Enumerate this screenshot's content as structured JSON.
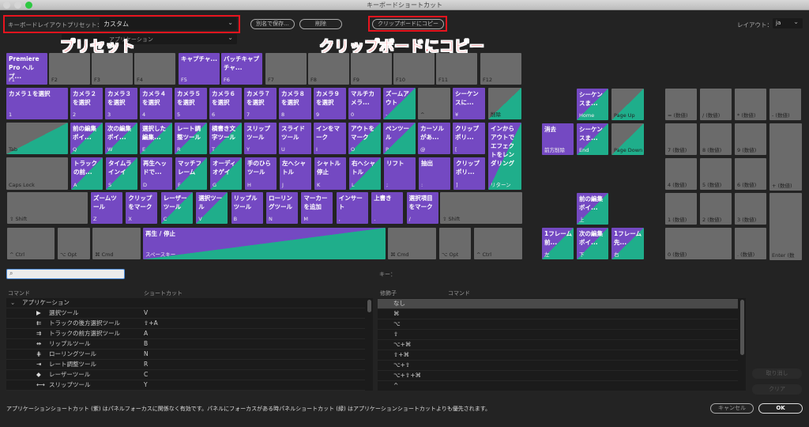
{
  "window": {
    "title": "キーボードショートカット"
  },
  "toolbar": {
    "preset_label": "キーボードレイアウトプリセット：",
    "preset_value": "カスタム",
    "save_as": "別名で保存...",
    "delete": "削除",
    "copy_clipboard": "クリップボードにコピー",
    "layout_label": "レイアウト：",
    "layout_value": "ja",
    "command_set_value": "アプリケーション"
  },
  "annotations": {
    "preset": "プリセット",
    "clipboard": "クリップボードにコピー"
  },
  "colors": {
    "app_shortcut": "#7449c2",
    "panel_shortcut": "#1fae8b",
    "unassigned": "#6b6b6b",
    "annotation": "#e8141e"
  },
  "keys": [
    {
      "k": "F1",
      "l": "Premiere Pro ヘルプ...",
      "s": "p"
    },
    {
      "k": "F2",
      "l": "",
      "s": "g"
    },
    {
      "k": "F3",
      "l": "",
      "s": "g"
    },
    {
      "k": "F4",
      "l": "",
      "s": "g"
    },
    {
      "k": "F5",
      "l": "キャプチャ...",
      "s": "p"
    },
    {
      "k": "F6",
      "l": "バッチキャプチャ...",
      "s": "p"
    },
    {
      "k": "F7",
      "l": "",
      "s": "g"
    },
    {
      "k": "F8",
      "l": "",
      "s": "g"
    },
    {
      "k": "F9",
      "l": "",
      "s": "g"
    },
    {
      "k": "F10",
      "l": "",
      "s": "g"
    },
    {
      "k": "F11",
      "l": "",
      "s": "g"
    },
    {
      "k": "F12",
      "l": "",
      "s": "g"
    },
    {
      "k": "1",
      "l": "カメラ１を選択",
      "s": "p"
    },
    {
      "k": "2",
      "l": "カメラ２を選択",
      "s": "p"
    },
    {
      "k": "3",
      "l": "カメラ３を選択",
      "s": "p"
    },
    {
      "k": "4",
      "l": "カメラ４を選択",
      "s": "p"
    },
    {
      "k": "5",
      "l": "カメラ５を選択",
      "s": "p"
    },
    {
      "k": "6",
      "l": "カメラ６を選択",
      "s": "p"
    },
    {
      "k": "7",
      "l": "カメラ７を選択",
      "s": "p"
    },
    {
      "k": "8",
      "l": "カメラ８を選択",
      "s": "p"
    },
    {
      "k": "9",
      "l": "カメラ９を選択",
      "s": "p"
    },
    {
      "k": "0",
      "l": "マルチカメラ...",
      "s": "p"
    },
    {
      "k": "-",
      "l": "ズームアウト",
      "s": "pg"
    },
    {
      "k": "^",
      "l": "",
      "s": "g"
    },
    {
      "k": "¥",
      "l": "シーケンスに...",
      "s": "p"
    },
    {
      "k": "削除",
      "l": "",
      "s": "gg"
    },
    {
      "k": "Tab",
      "l": "",
      "s": "gg"
    },
    {
      "k": "Q",
      "l": "前の編集ポイ...",
      "s": "pg"
    },
    {
      "k": "W",
      "l": "次の編集ポイ...",
      "s": "pg"
    },
    {
      "k": "E",
      "l": "選択した編集...",
      "s": "pg"
    },
    {
      "k": "R",
      "l": "レート調整ツール",
      "s": "pg"
    },
    {
      "k": "T",
      "l": "横書き文字ツール",
      "s": "pg"
    },
    {
      "k": "Y",
      "l": "スリップツール",
      "s": "p"
    },
    {
      "k": "U",
      "l": "スライドツール",
      "s": "p"
    },
    {
      "k": "I",
      "l": "インをマーク",
      "s": "p"
    },
    {
      "k": "O",
      "l": "アウトをマーク",
      "s": "pg"
    },
    {
      "k": "P",
      "l": "ペンツール",
      "s": "pg"
    },
    {
      "k": "@",
      "l": "カーソルがあ...",
      "s": "p"
    },
    {
      "k": "[",
      "l": "クリップポリ...",
      "s": "p"
    },
    {
      "k": "リターン",
      "l": "インからアウトでエフェクトをレンダリング",
      "s": "pg"
    },
    {
      "k": "Caps Lock",
      "l": "",
      "s": "g"
    },
    {
      "k": "A",
      "l": "トラックの前...",
      "s": "pg"
    },
    {
      "k": "S",
      "l": "タイムラインイン...",
      "s": "pg"
    },
    {
      "k": "D",
      "l": "再生ヘッドで...",
      "s": "p"
    },
    {
      "k": "F",
      "l": "マッチフレーム",
      "s": "pg"
    },
    {
      "k": "G",
      "l": "オーディオゲイン...",
      "s": "pg"
    },
    {
      "k": "H",
      "l": "手のひらツール",
      "s": "p"
    },
    {
      "k": "J",
      "l": "左へシャトル",
      "s": "p"
    },
    {
      "k": "K",
      "l": "シャトル停止",
      "s": "p"
    },
    {
      "k": "L",
      "l": "右へシャトル",
      "s": "pg"
    },
    {
      "k": ";",
      "l": "リフト",
      "s": "p"
    },
    {
      "k": ":",
      "l": "抽出",
      "s": "p"
    },
    {
      "k": "]",
      "l": "クリップポリ...",
      "s": "p"
    },
    {
      "k": "⇧ Shift",
      "l": "",
      "s": "g"
    },
    {
      "k": "Z",
      "l": "ズームツール",
      "s": "p"
    },
    {
      "k": "X",
      "l": "クリップをマーク",
      "s": "p"
    },
    {
      "k": "C",
      "l": "レーザーツール",
      "s": "pg"
    },
    {
      "k": "V",
      "l": "選択ツール",
      "s": "pg"
    },
    {
      "k": "B",
      "l": "リップルツール",
      "s": "p"
    },
    {
      "k": "N",
      "l": "ローリングツール",
      "s": "p"
    },
    {
      "k": "M",
      "l": "マーカーを追加",
      "s": "p"
    },
    {
      "k": ",",
      "l": "インサート",
      "s": "p"
    },
    {
      "k": ".",
      "l": "上書き",
      "s": "p"
    },
    {
      "k": "/",
      "l": "選択項目をマーク",
      "s": "p"
    },
    {
      "k": "⇧ Shift",
      "l": "",
      "s": "g"
    },
    {
      "k": "^ Ctrl",
      "l": "",
      "s": "g"
    },
    {
      "k": "⌥ Opt",
      "l": "",
      "s": "g"
    },
    {
      "k": "⌘ Cmd",
      "l": "",
      "s": "g"
    },
    {
      "k": "スペースキー",
      "l": "再生 / 停止",
      "s": "pg"
    },
    {
      "k": "⌘ Cmd",
      "l": "",
      "s": "g"
    },
    {
      "k": "⌥ Opt",
      "l": "",
      "s": "g"
    },
    {
      "k": "^ Ctrl",
      "l": "",
      "s": "g"
    },
    {
      "k": "前方削除",
      "l": "消去",
      "s": "p"
    },
    {
      "k": "Home",
      "l": "シーケンスま...",
      "s": "pg"
    },
    {
      "k": "Page Up",
      "l": "",
      "s": "gg"
    },
    {
      "k": "End",
      "l": "シーケンスま...",
      "s": "pg"
    },
    {
      "k": "Page Down",
      "l": "",
      "s": "gg"
    },
    {
      "k": "上",
      "l": "前の編集ポイ...",
      "s": "pg"
    },
    {
      "k": "左",
      "l": "1フレーム前...",
      "s": "pg"
    },
    {
      "k": "下",
      "l": "次の編集ポイ...",
      "s": "pg"
    },
    {
      "k": "右",
      "l": "1フレーム先...",
      "s": "pg"
    },
    {
      "k": "= (数値)",
      "l": "",
      "s": "g"
    },
    {
      "k": "/ (数値)",
      "l": "",
      "s": "g"
    },
    {
      "k": "* (数値)",
      "l": "",
      "s": "g"
    },
    {
      "k": "- (数値)",
      "l": "",
      "s": "g"
    },
    {
      "k": "7 (数値)",
      "l": "",
      "s": "g"
    },
    {
      "k": "8 (数値)",
      "l": "",
      "s": "g"
    },
    {
      "k": "9 (数値)",
      "l": "",
      "s": "g"
    },
    {
      "k": "+ (数値)",
      "l": "",
      "s": "g"
    },
    {
      "k": "4 (数値)",
      "l": "",
      "s": "g"
    },
    {
      "k": "5 (数値)",
      "l": "",
      "s": "g"
    },
    {
      "k": "6 (数値)",
      "l": "",
      "s": "g"
    },
    {
      "k": "1 (数値)",
      "l": "",
      "s": "g"
    },
    {
      "k": "2 (数値)",
      "l": "",
      "s": "g"
    },
    {
      "k": "3 (数値)",
      "l": "",
      "s": "g"
    },
    {
      "k": "Enter (数",
      "l": "",
      "s": "g"
    },
    {
      "k": "0 (数値)",
      "l": "",
      "s": "g"
    },
    {
      "k": ". (数値)",
      "l": "",
      "s": "g"
    }
  ],
  "commands": {
    "search_placeholder": "",
    "col_command": "コマンド",
    "col_shortcut": "ショートカット",
    "group": "アプリケーション",
    "rows": [
      {
        "name": "選択ツール",
        "shortcut": "V",
        "icon": "arrow-select-icon",
        "glyph": "▶"
      },
      {
        "name": "トラックの後方選択ツール",
        "shortcut": "⇧+A",
        "icon": "track-select-backward-icon",
        "glyph": "⇇"
      },
      {
        "name": "トラックの前方選択ツール",
        "shortcut": "A",
        "icon": "track-select-forward-icon",
        "glyph": "⇉"
      },
      {
        "name": "リップルツール",
        "shortcut": "B",
        "icon": "ripple-edit-icon",
        "glyph": "⇹"
      },
      {
        "name": "ローリングツール",
        "shortcut": "N",
        "icon": "rolling-edit-icon",
        "glyph": "⋕"
      },
      {
        "name": "レート調整ツール",
        "shortcut": "R",
        "icon": "rate-stretch-icon",
        "glyph": "⇥"
      },
      {
        "name": "レーザーツール",
        "shortcut": "C",
        "icon": "razor-icon",
        "glyph": "◆"
      },
      {
        "name": "スリップツール",
        "shortcut": "Y",
        "icon": "slip-icon",
        "glyph": "⟷"
      },
      {
        "name": "スライドツール",
        "shortcut": "U",
        "icon": "slide-icon",
        "glyph": "⇆"
      }
    ]
  },
  "modifiers": {
    "key_label": "キー：",
    "col_modifier": "修飾子",
    "col_command": "コマンド",
    "rows": [
      "なし",
      "⌘",
      "⌥",
      "⇧",
      "⌥+⌘",
      "⇧+⌘",
      "⌥+⇧",
      "⌥+⇧+⌘",
      "^",
      "^+⌘"
    ]
  },
  "actions": {
    "undo": "取り消し",
    "clear": "クリア",
    "cancel": "キャンセル",
    "ok": "OK"
  },
  "footer": "アプリケーションショートカット (紫) はパネルフォーカスに関係なく有効です。パネルにフォーカスがある時パネルショートカット (緑) はアプリケーションショートカットよりも優先されます。"
}
